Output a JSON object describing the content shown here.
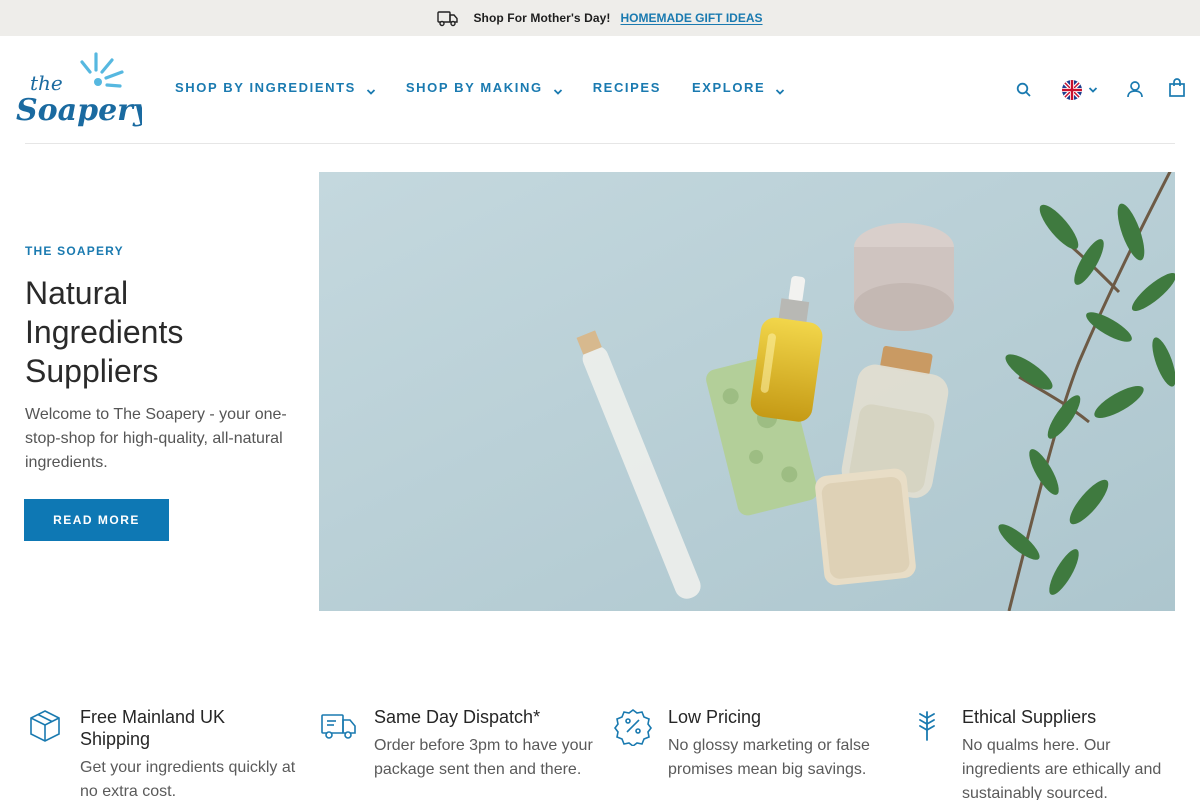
{
  "announcement": {
    "icon": "delivery-truck-icon",
    "message": "Shop For Mother's Day!",
    "link_text": "HOMEMADE GIFT IDEAS"
  },
  "header": {
    "logo_text": "The Soapery",
    "nav": [
      {
        "label": "SHOP BY INGREDIENTS",
        "has_dropdown": true
      },
      {
        "label": "SHOP BY MAKING",
        "has_dropdown": true
      },
      {
        "label": "RECIPES",
        "has_dropdown": false
      },
      {
        "label": "EXPLORE",
        "has_dropdown": true
      }
    ],
    "icons": {
      "search": "search-icon",
      "language": "uk-flag-icon",
      "account": "user-icon",
      "cart": "shopping-bag-icon"
    }
  },
  "hero": {
    "eyebrow": "THE SOAPERY",
    "title_line1": "Natural",
    "title_line2": "Ingredients",
    "title_line3": "Suppliers",
    "text": "Welcome to The Soapery - your one-stop-shop for high-quality, all-natural ingredients.",
    "button": "READ MORE",
    "image": "natural-ingredients-photo"
  },
  "features": [
    {
      "icon": "box-icon",
      "title": "Free Mainland UK Shipping",
      "text": "Get your ingredients quickly at no extra cost."
    },
    {
      "icon": "delivery-truck-icon",
      "title": "Same Day Dispatch*",
      "text": "Order before 3pm to have your package sent then and there."
    },
    {
      "icon": "discount-badge-icon",
      "title": "Low Pricing",
      "text": "No glossy marketing or false promises mean big savings."
    },
    {
      "icon": "plant-stem-icon",
      "title": "Ethical Suppliers",
      "text": "No qualms here. Our ingredients are ethically and sustainably sourced."
    }
  ],
  "colors": {
    "brand_blue": "#1a7ab0",
    "button_blue": "#0e78b4",
    "announcement_bg": "#eeedea"
  }
}
